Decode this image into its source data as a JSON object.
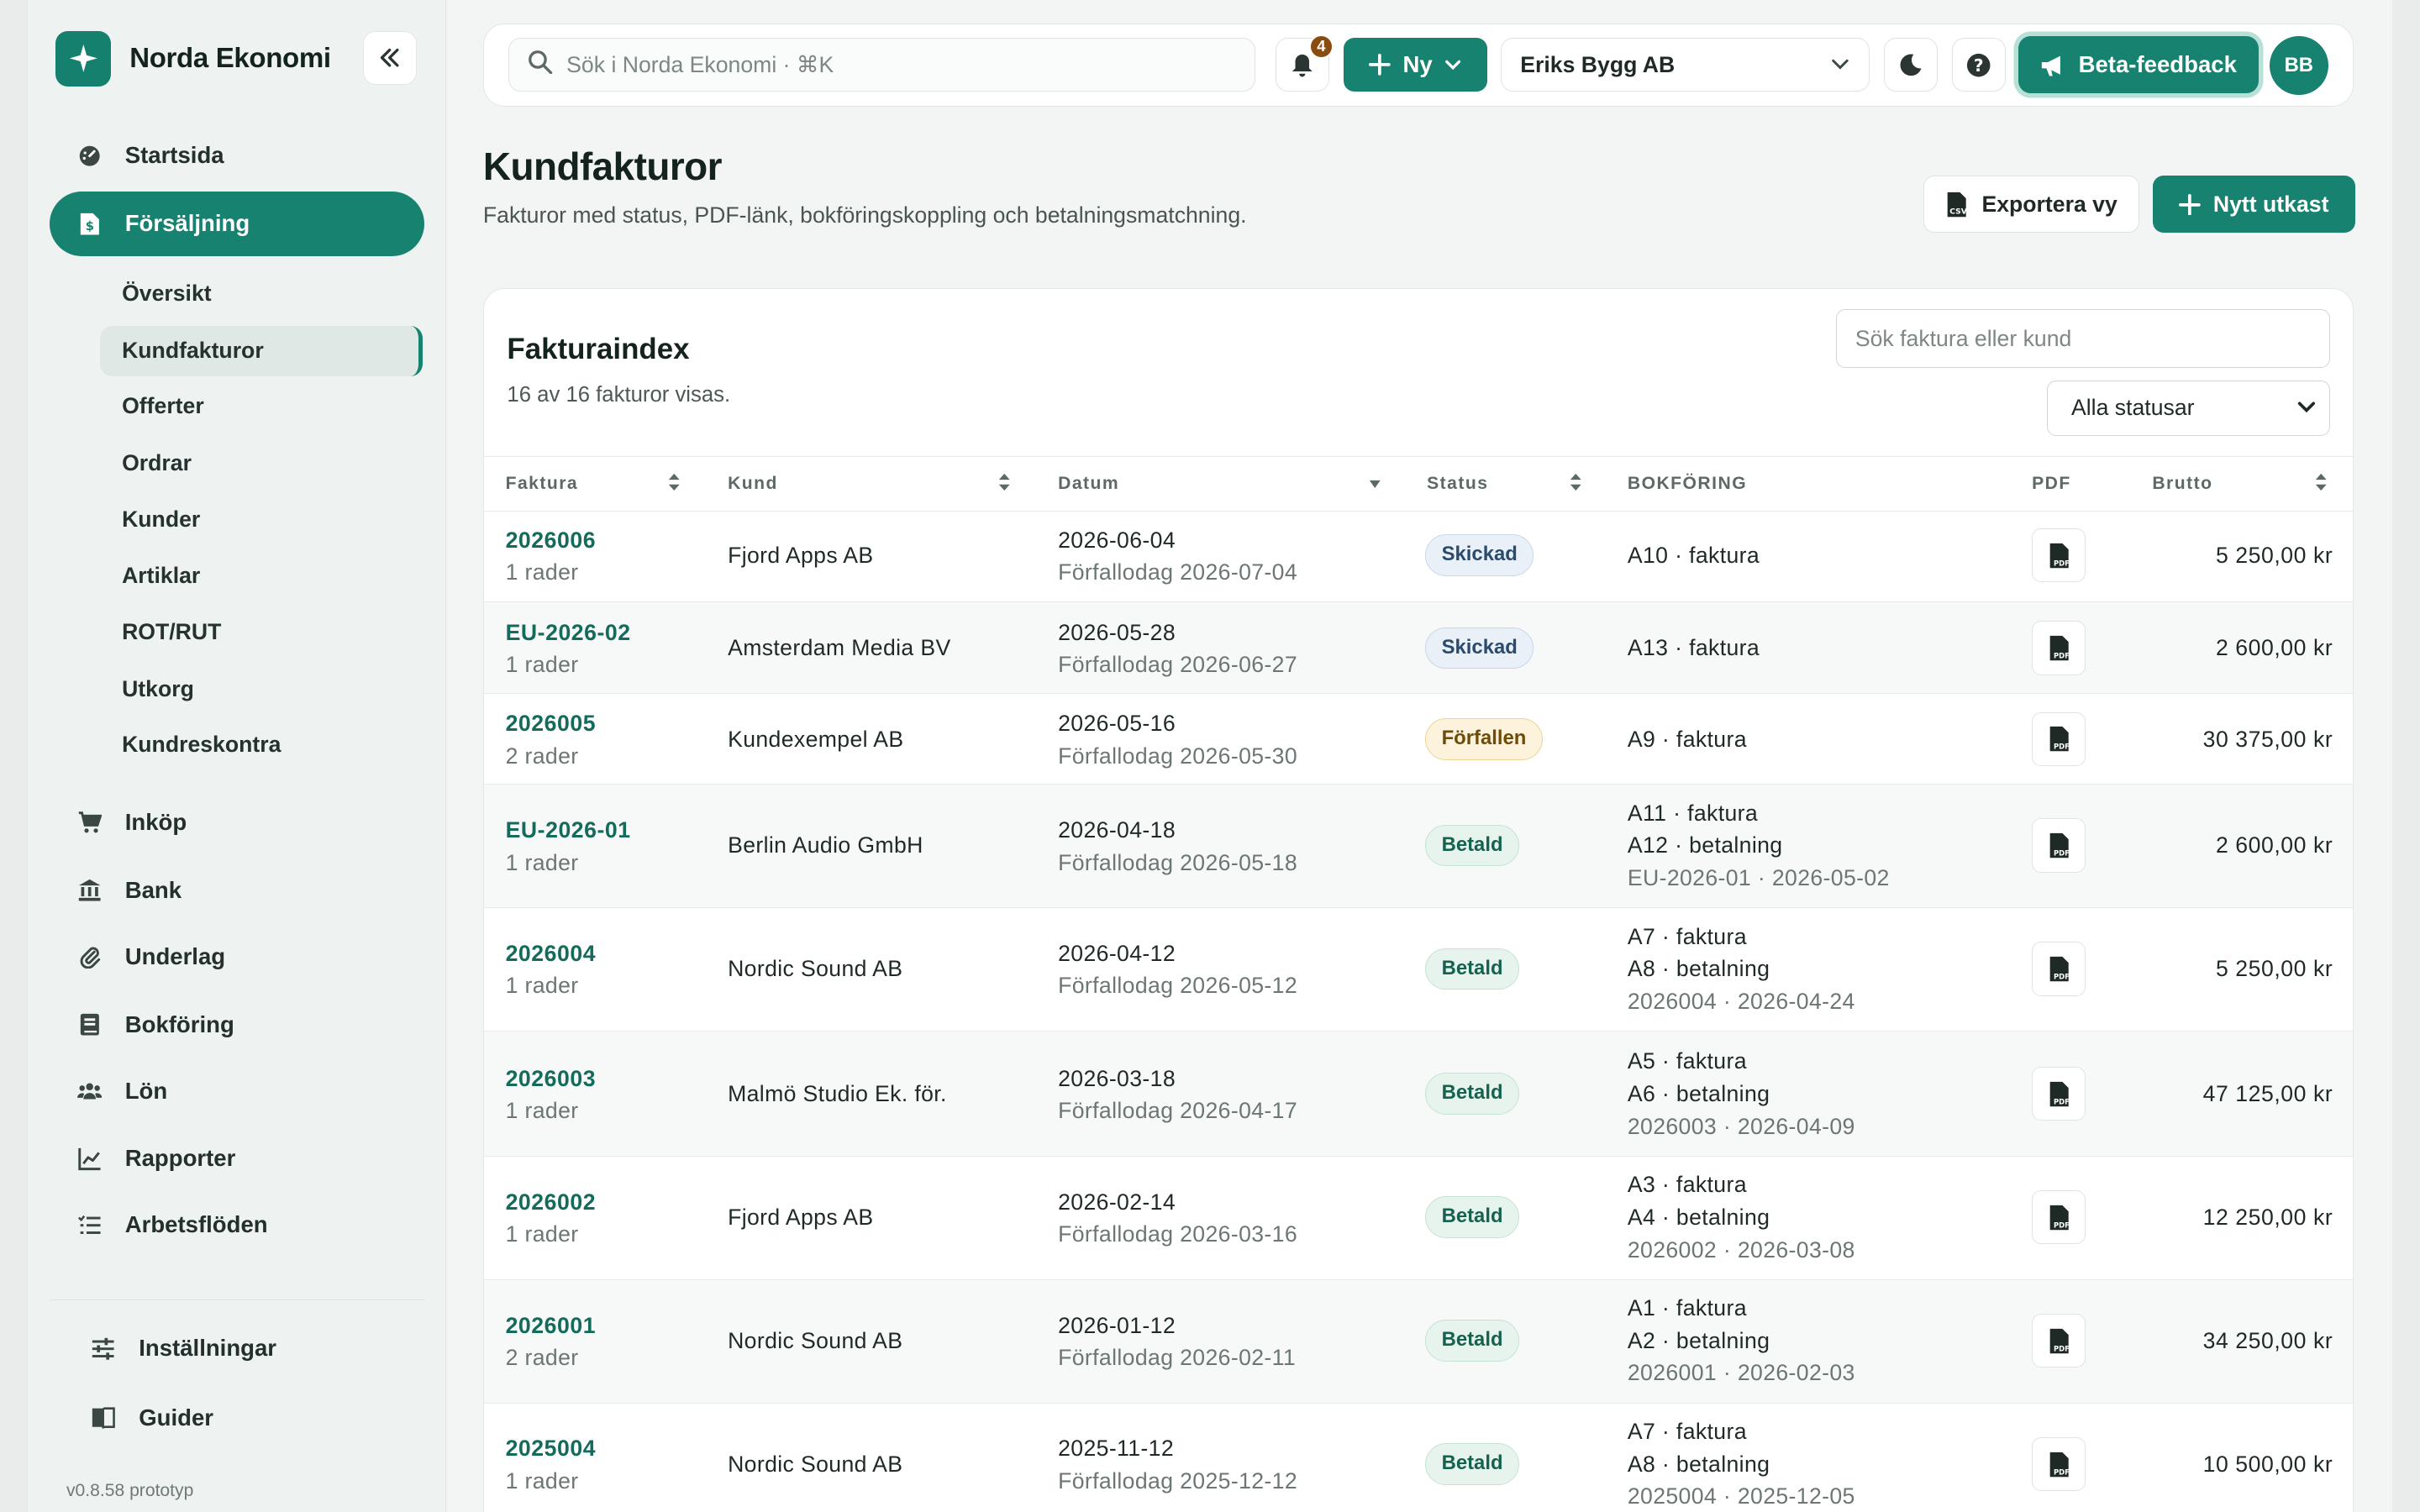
{
  "brand": {
    "name": "Norda Ekonomi"
  },
  "sidebar": {
    "items": [
      {
        "label": "Startsida",
        "icon": "dashboard-icon"
      },
      {
        "label": "Försäljning",
        "icon": "invoice-icon"
      },
      {
        "label": "Inköp",
        "icon": "cart-icon"
      },
      {
        "label": "Bank",
        "icon": "bank-icon"
      },
      {
        "label": "Underlag",
        "icon": "paperclip-icon"
      },
      {
        "label": "Bokföring",
        "icon": "book-icon"
      },
      {
        "label": "Lön",
        "icon": "people-icon"
      },
      {
        "label": "Rapporter",
        "icon": "chart-icon"
      },
      {
        "label": "Arbetsflöden",
        "icon": "checklist-icon"
      }
    ],
    "sub_items": [
      "Översikt",
      "Kundfakturor",
      "Offerter",
      "Ordrar",
      "Kunder",
      "Artiklar",
      "ROT/RUT",
      "Utkorg",
      "Kundreskontra"
    ],
    "bottom": [
      {
        "label": "Inställningar",
        "icon": "sliders-icon"
      },
      {
        "label": "Guider",
        "icon": "guide-icon"
      }
    ],
    "version": "v0.8.58 prototyp"
  },
  "topbar": {
    "search_placeholder": "Sök i Norda Ekonomi · ⌘K",
    "notification_count": "4",
    "new_label": "Ny",
    "company": "Eriks Bygg AB",
    "beta_label": "Beta-feedback",
    "avatar_initials": "BB"
  },
  "page": {
    "title": "Kundfakturor",
    "subtitle": "Fakturor med status, PDF-länk, bokföringskoppling och betalningsmatchning.",
    "export_label": "Exportera vy",
    "new_draft_label": "Nytt utkast"
  },
  "card": {
    "title": "Fakturaindex",
    "count_text": "16 av 16 fakturor visas.",
    "search_placeholder": "Sök faktura eller kund",
    "status_filter": "Alla statusar"
  },
  "table": {
    "columns": [
      "Faktura",
      "Kund",
      "Datum",
      "Status",
      "BOKFÖRING",
      "PDF",
      "Brutto"
    ],
    "rows": [
      {
        "invoice": "2026006",
        "lines": "1 rader",
        "customer": "Fjord Apps AB",
        "date": "2026-06-04",
        "due": "Förfallodag 2026-07-04",
        "status": "Skickad",
        "status_kind": "skickad",
        "booking": [
          "A10 · faktura"
        ],
        "booking_note": "",
        "gross": "5 250,00 kr"
      },
      {
        "invoice": "EU-2026-02",
        "lines": "1 rader",
        "customer": "Amsterdam Media BV",
        "date": "2026-05-28",
        "due": "Förfallodag 2026-06-27",
        "status": "Skickad",
        "status_kind": "skickad",
        "booking": [
          "A13 · faktura"
        ],
        "booking_note": "",
        "gross": "2 600,00 kr"
      },
      {
        "invoice": "2026005",
        "lines": "2 rader",
        "customer": "Kundexempel AB",
        "date": "2026-05-16",
        "due": "Förfallodag 2026-05-30",
        "status": "Förfallen",
        "status_kind": "forfallen",
        "booking": [
          "A9 · faktura"
        ],
        "booking_note": "",
        "gross": "30 375,00 kr"
      },
      {
        "invoice": "EU-2026-01",
        "lines": "1 rader",
        "customer": "Berlin Audio GmbH",
        "date": "2026-04-18",
        "due": "Förfallodag 2026-05-18",
        "status": "Betald",
        "status_kind": "betald",
        "booking": [
          "A11 · faktura",
          "A12 · betalning"
        ],
        "booking_note": "EU-2026-01 · 2026-05-02",
        "gross": "2 600,00 kr"
      },
      {
        "invoice": "2026004",
        "lines": "1 rader",
        "customer": "Nordic Sound AB",
        "date": "2026-04-12",
        "due": "Förfallodag 2026-05-12",
        "status": "Betald",
        "status_kind": "betald",
        "booking": [
          "A7 · faktura",
          "A8 · betalning"
        ],
        "booking_note": "2026004 · 2026-04-24",
        "gross": "5 250,00 kr"
      },
      {
        "invoice": "2026003",
        "lines": "1 rader",
        "customer": "Malmö Studio Ek. för.",
        "date": "2026-03-18",
        "due": "Förfallodag 2026-04-17",
        "status": "Betald",
        "status_kind": "betald",
        "booking": [
          "A5 · faktura",
          "A6 · betalning"
        ],
        "booking_note": "2026003 · 2026-04-09",
        "gross": "47 125,00 kr"
      },
      {
        "invoice": "2026002",
        "lines": "1 rader",
        "customer": "Fjord Apps AB",
        "date": "2026-02-14",
        "due": "Förfallodag 2026-03-16",
        "status": "Betald",
        "status_kind": "betald",
        "booking": [
          "A3 · faktura",
          "A4 · betalning"
        ],
        "booking_note": "2026002 · 2026-03-08",
        "gross": "12 250,00 kr"
      },
      {
        "invoice": "2026001",
        "lines": "2 rader",
        "customer": "Nordic Sound AB",
        "date": "2026-01-12",
        "due": "Förfallodag 2026-02-11",
        "status": "Betald",
        "status_kind": "betald",
        "booking": [
          "A1 · faktura",
          "A2 · betalning"
        ],
        "booking_note": "2026001 · 2026-02-03",
        "gross": "34 250,00 kr"
      },
      {
        "invoice": "2025004",
        "lines": "1 rader",
        "customer": "Nordic Sound AB",
        "date": "2025-11-12",
        "due": "Förfallodag 2025-12-12",
        "status": "Betald",
        "status_kind": "betald",
        "booking": [
          "A7 · faktura",
          "A8 · betalning"
        ],
        "booking_note": "2025004 · 2025-12-05",
        "gross": "10 500,00 kr"
      }
    ]
  },
  "colors": {
    "accent": "#16826f",
    "link": "#146b5c"
  }
}
